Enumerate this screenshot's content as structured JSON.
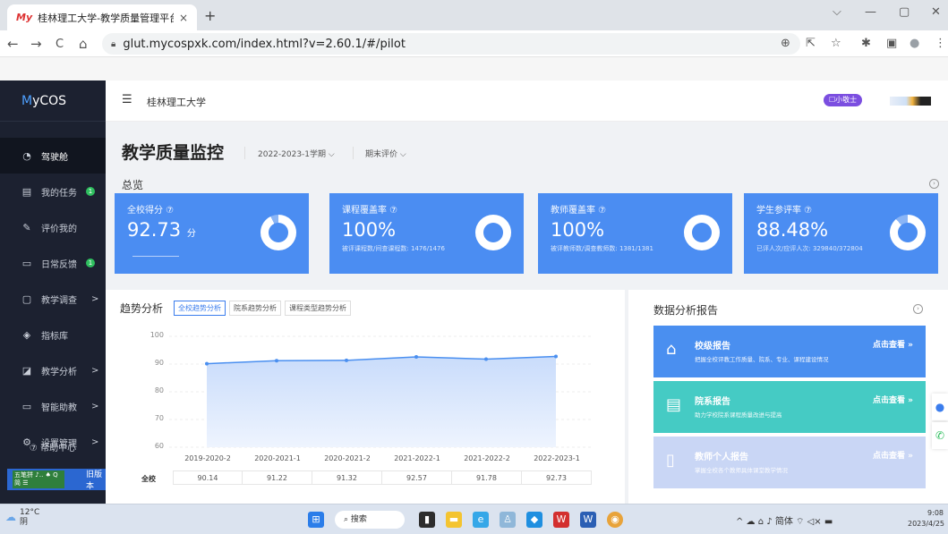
{
  "browser": {
    "tab_title": "桂林理工大学-教学质量管理平台",
    "tab_favicon": "My",
    "tab_close": "×",
    "new_tab": "+",
    "url": "glut.mycospxk.com/index.html?v=2.60.1/#/pilot",
    "window": {
      "minimize": "—",
      "restore": "▢",
      "close": "✕",
      "dropdown": "⌵"
    },
    "nav": {
      "back": "←",
      "forward": "→",
      "reload": "C",
      "home": "⌂"
    },
    "addr_icons": {
      "zoom": "⊕",
      "share": "⇱",
      "bookmark": "☆",
      "extensions": "✱",
      "sidebar": "▣",
      "profile": "●",
      "menu": "⋮"
    }
  },
  "sidebar": {
    "brand_prefix": "M",
    "brand_rest": "yCOS",
    "items": [
      {
        "label": "驾驶舱",
        "icon": "dashboard-icon",
        "glyph": "◔",
        "active": true
      },
      {
        "label": "我的任务",
        "icon": "tasks-icon",
        "glyph": "▤",
        "badge": "1"
      },
      {
        "label": "评价我的",
        "icon": "evaluate-icon",
        "glyph": "✎"
      },
      {
        "label": "日常反馈",
        "icon": "feedback-icon",
        "glyph": "▭",
        "badge": "1"
      },
      {
        "label": "教学调查",
        "icon": "survey-icon",
        "glyph": "▢",
        "arrow": ">"
      },
      {
        "label": "指标库",
        "icon": "index-library-icon",
        "glyph": "◈"
      },
      {
        "label": "教学分析",
        "icon": "analysis-icon",
        "glyph": "◪",
        "arrow": ">"
      },
      {
        "label": "智能助教",
        "icon": "assistant-icon",
        "glyph": "▭",
        "arrow": ">"
      },
      {
        "label": "设置管理",
        "icon": "settings-icon",
        "glyph": "⚙",
        "arrow": ">"
      }
    ],
    "help": "⑦ 帮助中心",
    "old_version": "旧版本",
    "ime_tag": "五笔拼 ♪‥ ♠ Q 简 ☰"
  },
  "header": {
    "school": "桂林理工大学",
    "menu_icon": "☰",
    "pill": "☐小敬士"
  },
  "main": {
    "title": "教学质量监控",
    "term": "2022-2023-1学期 ⌵",
    "eval_type": "期末评价 ⌵",
    "overview_label": "总览",
    "kpis": [
      {
        "label": "全校得分 ⑦",
        "value": "92.73",
        "unit": "分",
        "sub": "",
        "ring_fill": 0.9273
      },
      {
        "label": "课程覆盖率 ⑦",
        "value": "100%",
        "unit": "",
        "sub": "被评课程数/间查课程数: 1476/1476",
        "ring_fill": 1.0
      },
      {
        "label": "教师覆盖率 ⑦",
        "value": "100%",
        "unit": "",
        "sub": "被评教师数/调查教师数: 1381/1381",
        "ring_fill": 1.0
      },
      {
        "label": "学生参评率 ⑦",
        "value": "88.48%",
        "unit": "",
        "sub": "已评人次/应评人次: 329840/372804",
        "ring_fill": 0.8848
      }
    ],
    "trend": {
      "title": "趋势分析",
      "tabs": [
        "全校趋势分析",
        "院系趋势分析",
        "课程类型趋势分析"
      ],
      "row_label": "全校"
    },
    "reports": {
      "title": "数据分析报告",
      "cards": [
        {
          "title": "校级报告",
          "desc": "把握全校评教工作质量、院系、专业、课程建设情况",
          "link": "点击查看 »",
          "color": "#4a8ff0",
          "icon": "school-report-icon",
          "glyph": "⌂"
        },
        {
          "title": "院系报告",
          "desc": "助力学校院系课程质量改进与提高",
          "link": "点击查看 »",
          "color": "#45cbc4",
          "icon": "department-report-icon",
          "glyph": "▤"
        },
        {
          "title": "教师个人报告",
          "desc": "掌握全校各个教师具体课堂教学情况",
          "link": "点击查看 »",
          "color": "#c9d6f5",
          "icon": "teacher-report-icon",
          "glyph": "▯"
        }
      ]
    }
  },
  "chart_data": {
    "type": "line",
    "categories": [
      "2019-2020-2",
      "2020-2021-1",
      "2020-2021-2",
      "2021-2022-1",
      "2021-2022-2",
      "2022-2023-1"
    ],
    "series": [
      {
        "name": "全校",
        "values": [
          90.14,
          91.22,
          91.32,
          92.57,
          91.78,
          92.73
        ]
      }
    ],
    "yticks": [
      60,
      70,
      80,
      90,
      100
    ],
    "ylim": [
      60,
      100
    ],
    "grid": true,
    "line_color": "#4a8ff0"
  },
  "taskbar": {
    "temp": "12°C",
    "weather": "阴",
    "search": "⌕ 搜索",
    "tray": "^ ☁ ⌂ ♪ 简体 ⌔ ◁× ▬",
    "time": "9:08",
    "date": "2023/4/25"
  }
}
